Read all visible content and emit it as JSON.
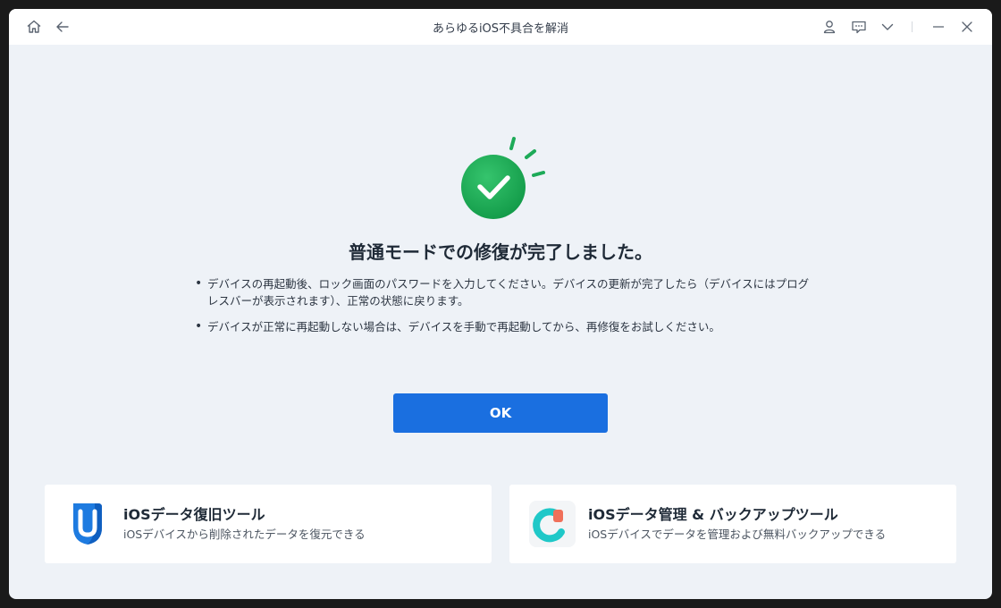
{
  "window": {
    "title": "あらゆるiOS不具合を解消"
  },
  "titlebar": {
    "icons": [
      "home-icon",
      "back-arrow-icon",
      "user-icon",
      "feedback-icon",
      "chevron-down-icon",
      "minimize-icon",
      "close-icon"
    ]
  },
  "result": {
    "status": "success",
    "headline": "普通モードでの修復が完了しました。",
    "notes": [
      "デバイスの再起動後、ロック画面のパスワードを入力してください。デバイスの更新が完了したら（デバイスにはプログレスバーが表示されます）、正常の状態に戻ります。",
      "デバイスが正常に再起動しない場合は、デバイスを手動で再起動してから、再修復をお試しください。"
    ],
    "ok_label": "OK"
  },
  "cards": [
    {
      "icon": "ultdata-app-icon",
      "title": "iOSデータ復旧ツール",
      "subtitle": "iOSデバイスから削除されたデータを復元できる"
    },
    {
      "icon": "icarefone-app-icon",
      "title": "iOSデータ管理 & バックアップツール",
      "subtitle": "iOSデバイスでデータを管理および無料バックアップできる"
    }
  ],
  "colors": {
    "accent": "#1a6fe0",
    "success": "#22a556",
    "background": "#eef2f7"
  }
}
